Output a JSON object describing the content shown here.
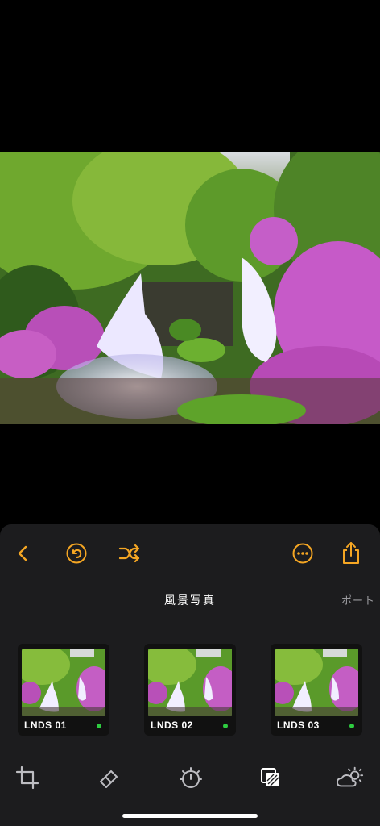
{
  "photo": {
    "description_icon": "waterfall-photo"
  },
  "toolbar": {
    "accent": "#f5a623",
    "buttons": [
      {
        "icon": "chevron-left-icon"
      },
      {
        "icon": "undo-icon"
      },
      {
        "icon": "shuffle-icon"
      },
      {
        "icon": "more-icon"
      },
      {
        "icon": "share-icon"
      }
    ]
  },
  "tabs": {
    "active": "風景写真",
    "next": "ポート"
  },
  "presets": [
    {
      "label": "LNDS 01",
      "status_color": "#2ecc40"
    },
    {
      "label": "LNDS 02",
      "status_color": "#2ecc40"
    },
    {
      "label": "LNDS 03",
      "status_color": "#2ecc40"
    }
  ],
  "tools": [
    {
      "icon": "crop-icon"
    },
    {
      "icon": "eraser-icon"
    },
    {
      "icon": "timer-icon"
    },
    {
      "icon": "layers-icon",
      "active": true
    },
    {
      "icon": "weather-icon"
    }
  ]
}
